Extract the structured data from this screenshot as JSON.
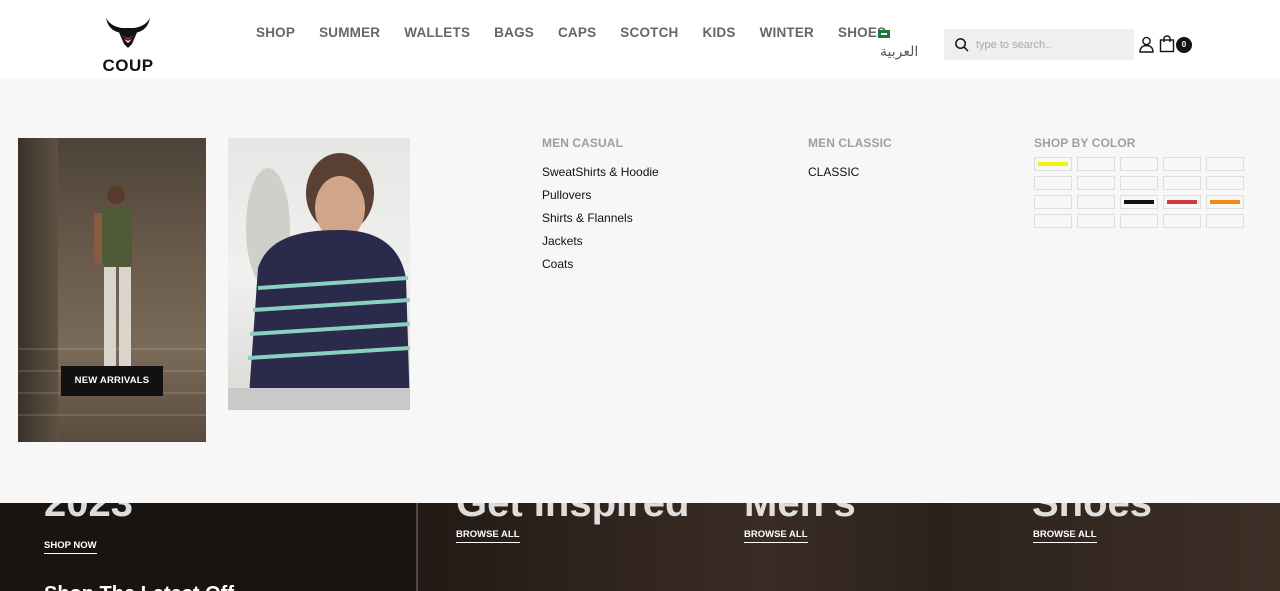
{
  "header": {
    "logo_text": "COUP",
    "nav": [
      "SHOP",
      "SUMMER",
      "WALLETS",
      "BAGS",
      "CAPS",
      "SCOTCH",
      "KIDS",
      "WINTER",
      "SHOES"
    ],
    "language_label": "العربية",
    "search_placeholder": "type to search..",
    "cart_count": "0"
  },
  "mega_menu": {
    "promo_button": "NEW ARRIVALS",
    "men_casual": {
      "title": "MEN CASUAL",
      "links": [
        "SweatShirts & Hoodie",
        "Pullovers",
        "Shirts & Flannels",
        "Jackets",
        "Coats"
      ]
    },
    "men_classic": {
      "title": "MEN CLASSIC",
      "links": [
        "CLASSIC"
      ]
    },
    "shop_by_color": {
      "title": "SHOP BY COLOR",
      "swatches": [
        "#f2f20a",
        "",
        "",
        "",
        "",
        "",
        "",
        "",
        "",
        "",
        "",
        "",
        "#111111",
        "#d43a3a",
        "#f08a10",
        "",
        "",
        "",
        "",
        ""
      ]
    }
  },
  "hero": {
    "links": [
      "SHOP NOW",
      "BROWSE ALL",
      "BROWSE ALL",
      "BROWSE ALL"
    ],
    "big_texts": [
      "2023",
      "Get Inspired",
      "Men's",
      "Shoes"
    ],
    "subtitle": "Shop The Latest Off"
  }
}
